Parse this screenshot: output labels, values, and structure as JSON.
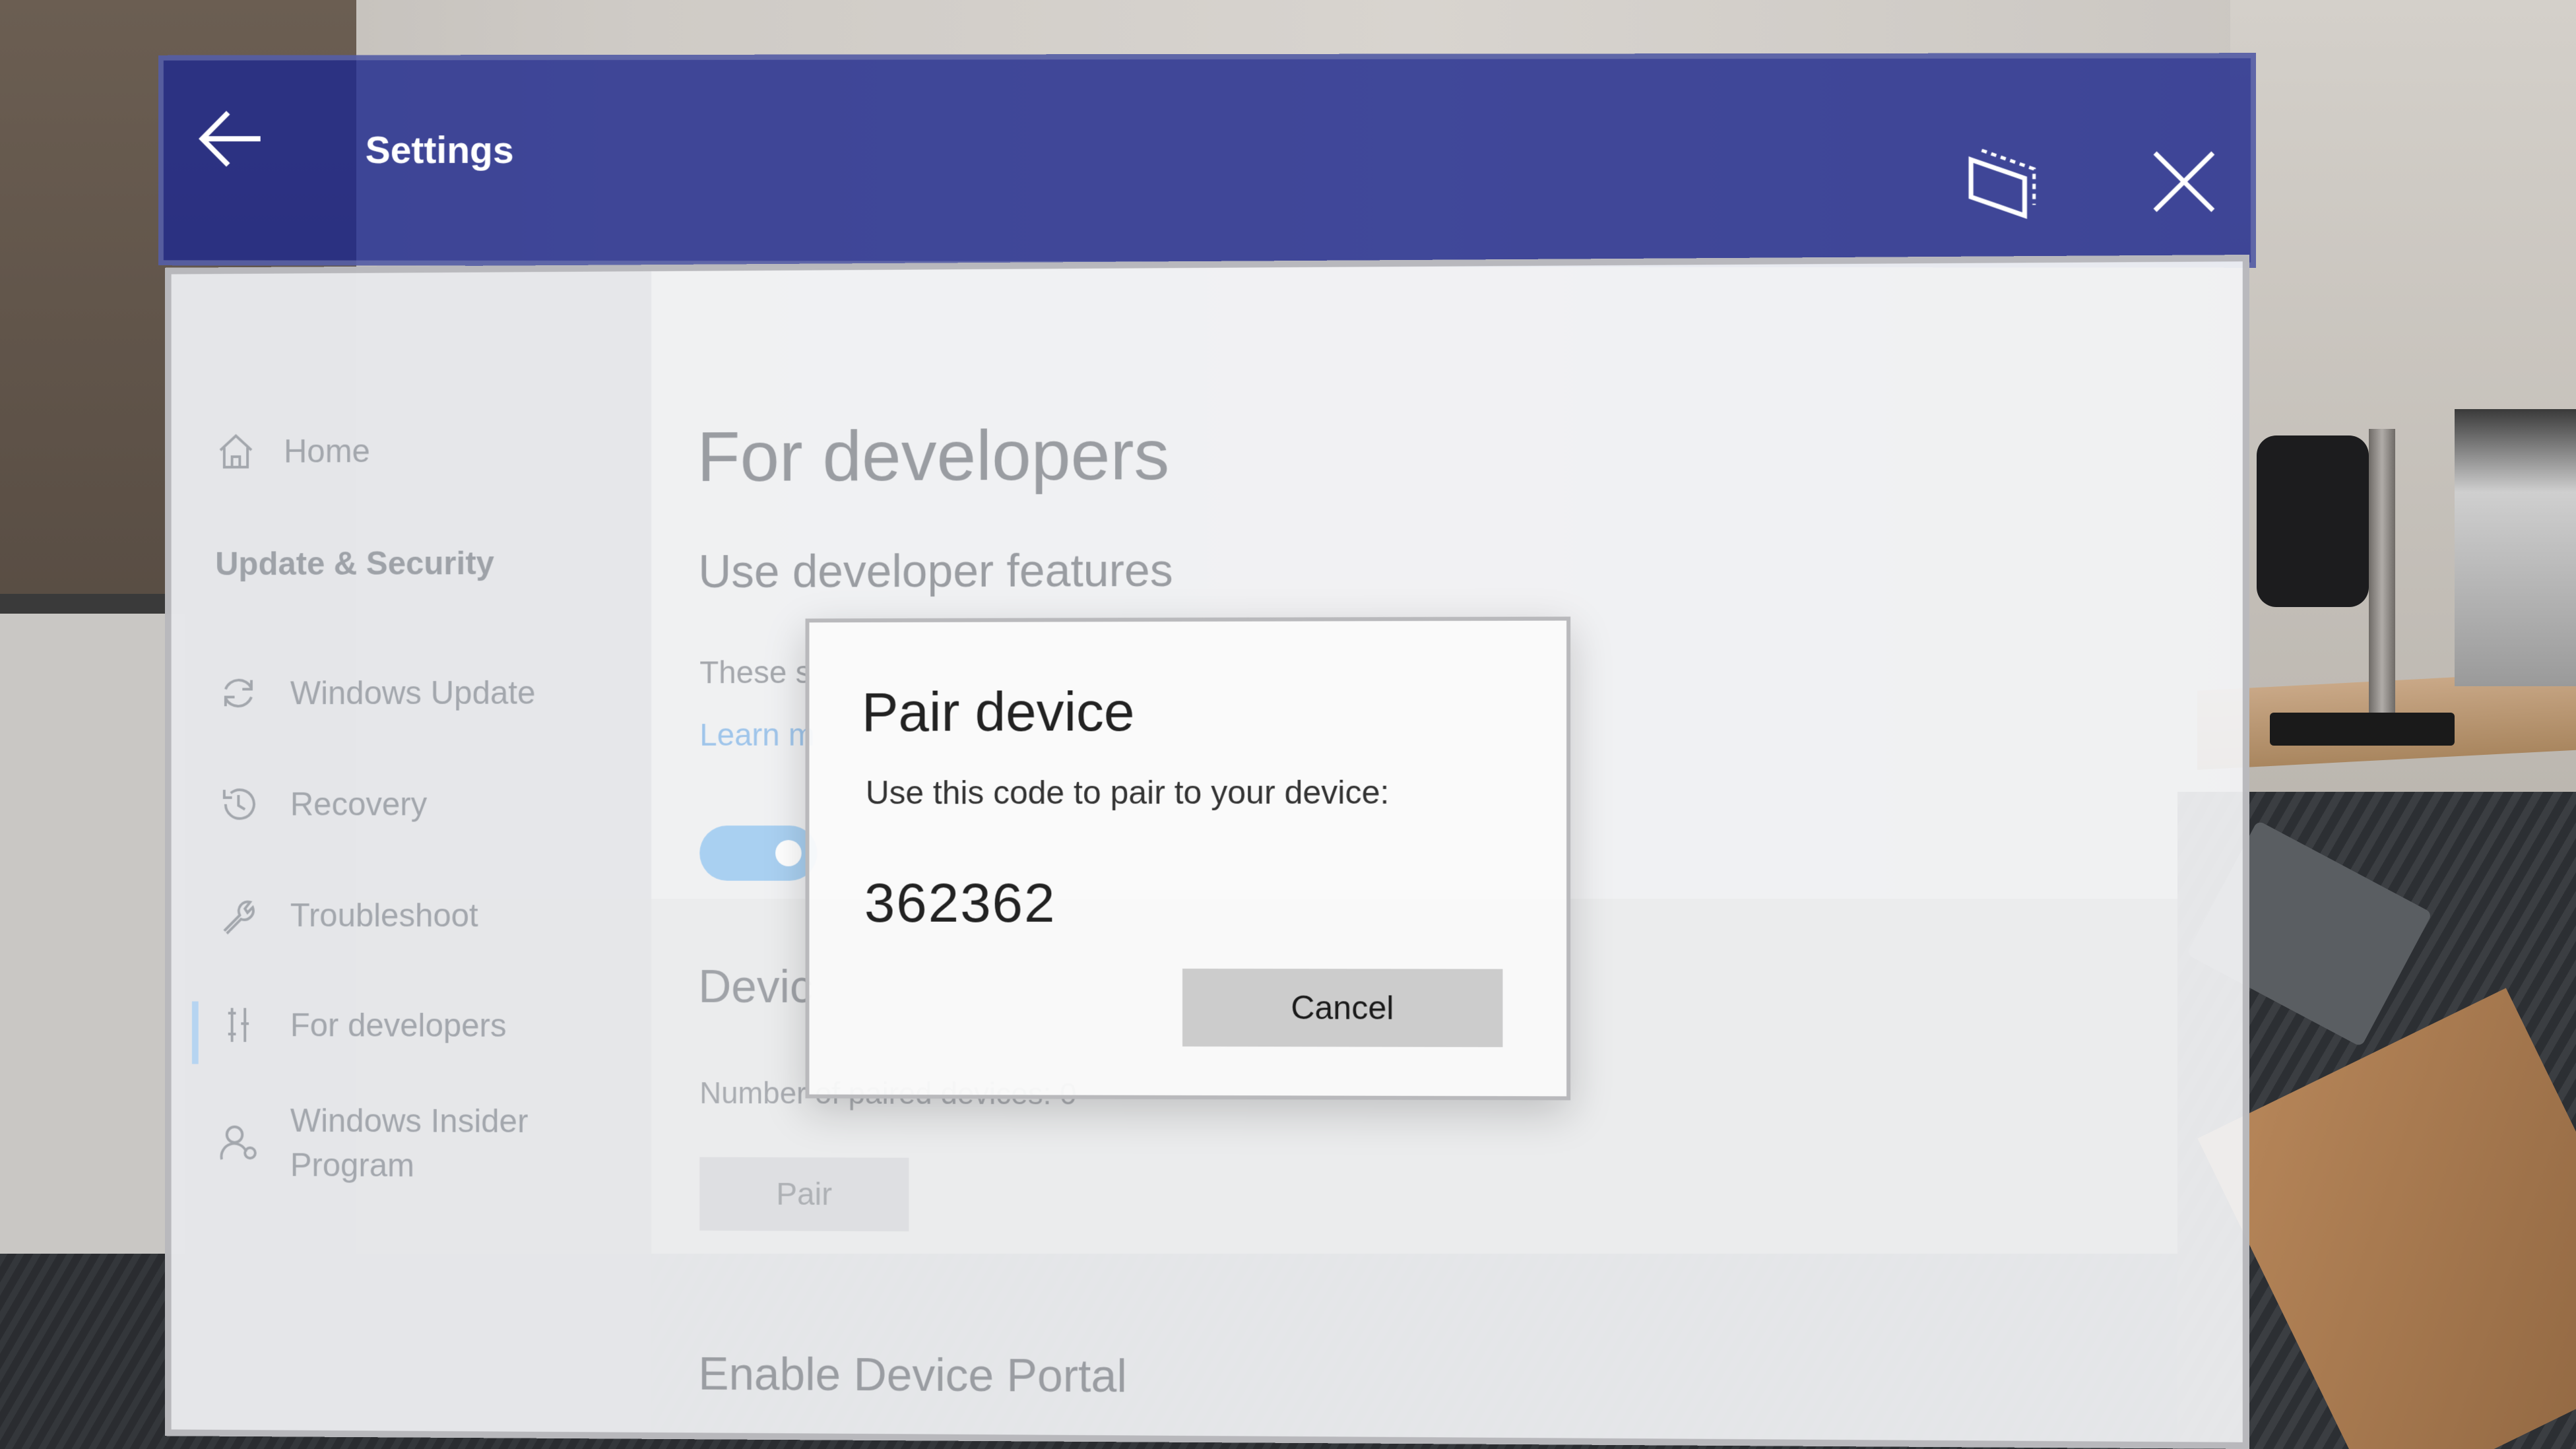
{
  "titlebar": {
    "title": "Settings",
    "back_icon": "back-arrow-icon",
    "adjust_icon": "adjust-window-icon",
    "close_icon": "close-icon",
    "background_color": "#1e288c"
  },
  "sidebar": {
    "home_label": "Home",
    "section_title": "Update & Security",
    "items": [
      {
        "label": "Windows Update",
        "icon": "refresh-icon",
        "selected": false
      },
      {
        "label": "Recovery",
        "icon": "history-icon",
        "selected": false
      },
      {
        "label": "Troubleshoot",
        "icon": "wrench-icon",
        "selected": false
      },
      {
        "label": "For developers",
        "icon": "developer-tools-icon",
        "selected": true
      },
      {
        "label": "Windows Insider Program",
        "label_line1": "Windows Insider",
        "label_line2": "Program",
        "icon": "insider-icon",
        "selected": false
      }
    ]
  },
  "main": {
    "page_title": "For developers",
    "section1": "Use developer features",
    "description_partial": "These s",
    "learn_more_partial": "Learn m",
    "developer_mode_toggle": "on",
    "section2_partial": "Devic",
    "paired_devices_partial": "Number of paired devices: 0",
    "pair_button": "Pair",
    "section3": "Enable Device Portal"
  },
  "dialog": {
    "title": "Pair device",
    "text": "Use this code to pair to your device:",
    "code": "362362",
    "cancel_label": "Cancel"
  }
}
